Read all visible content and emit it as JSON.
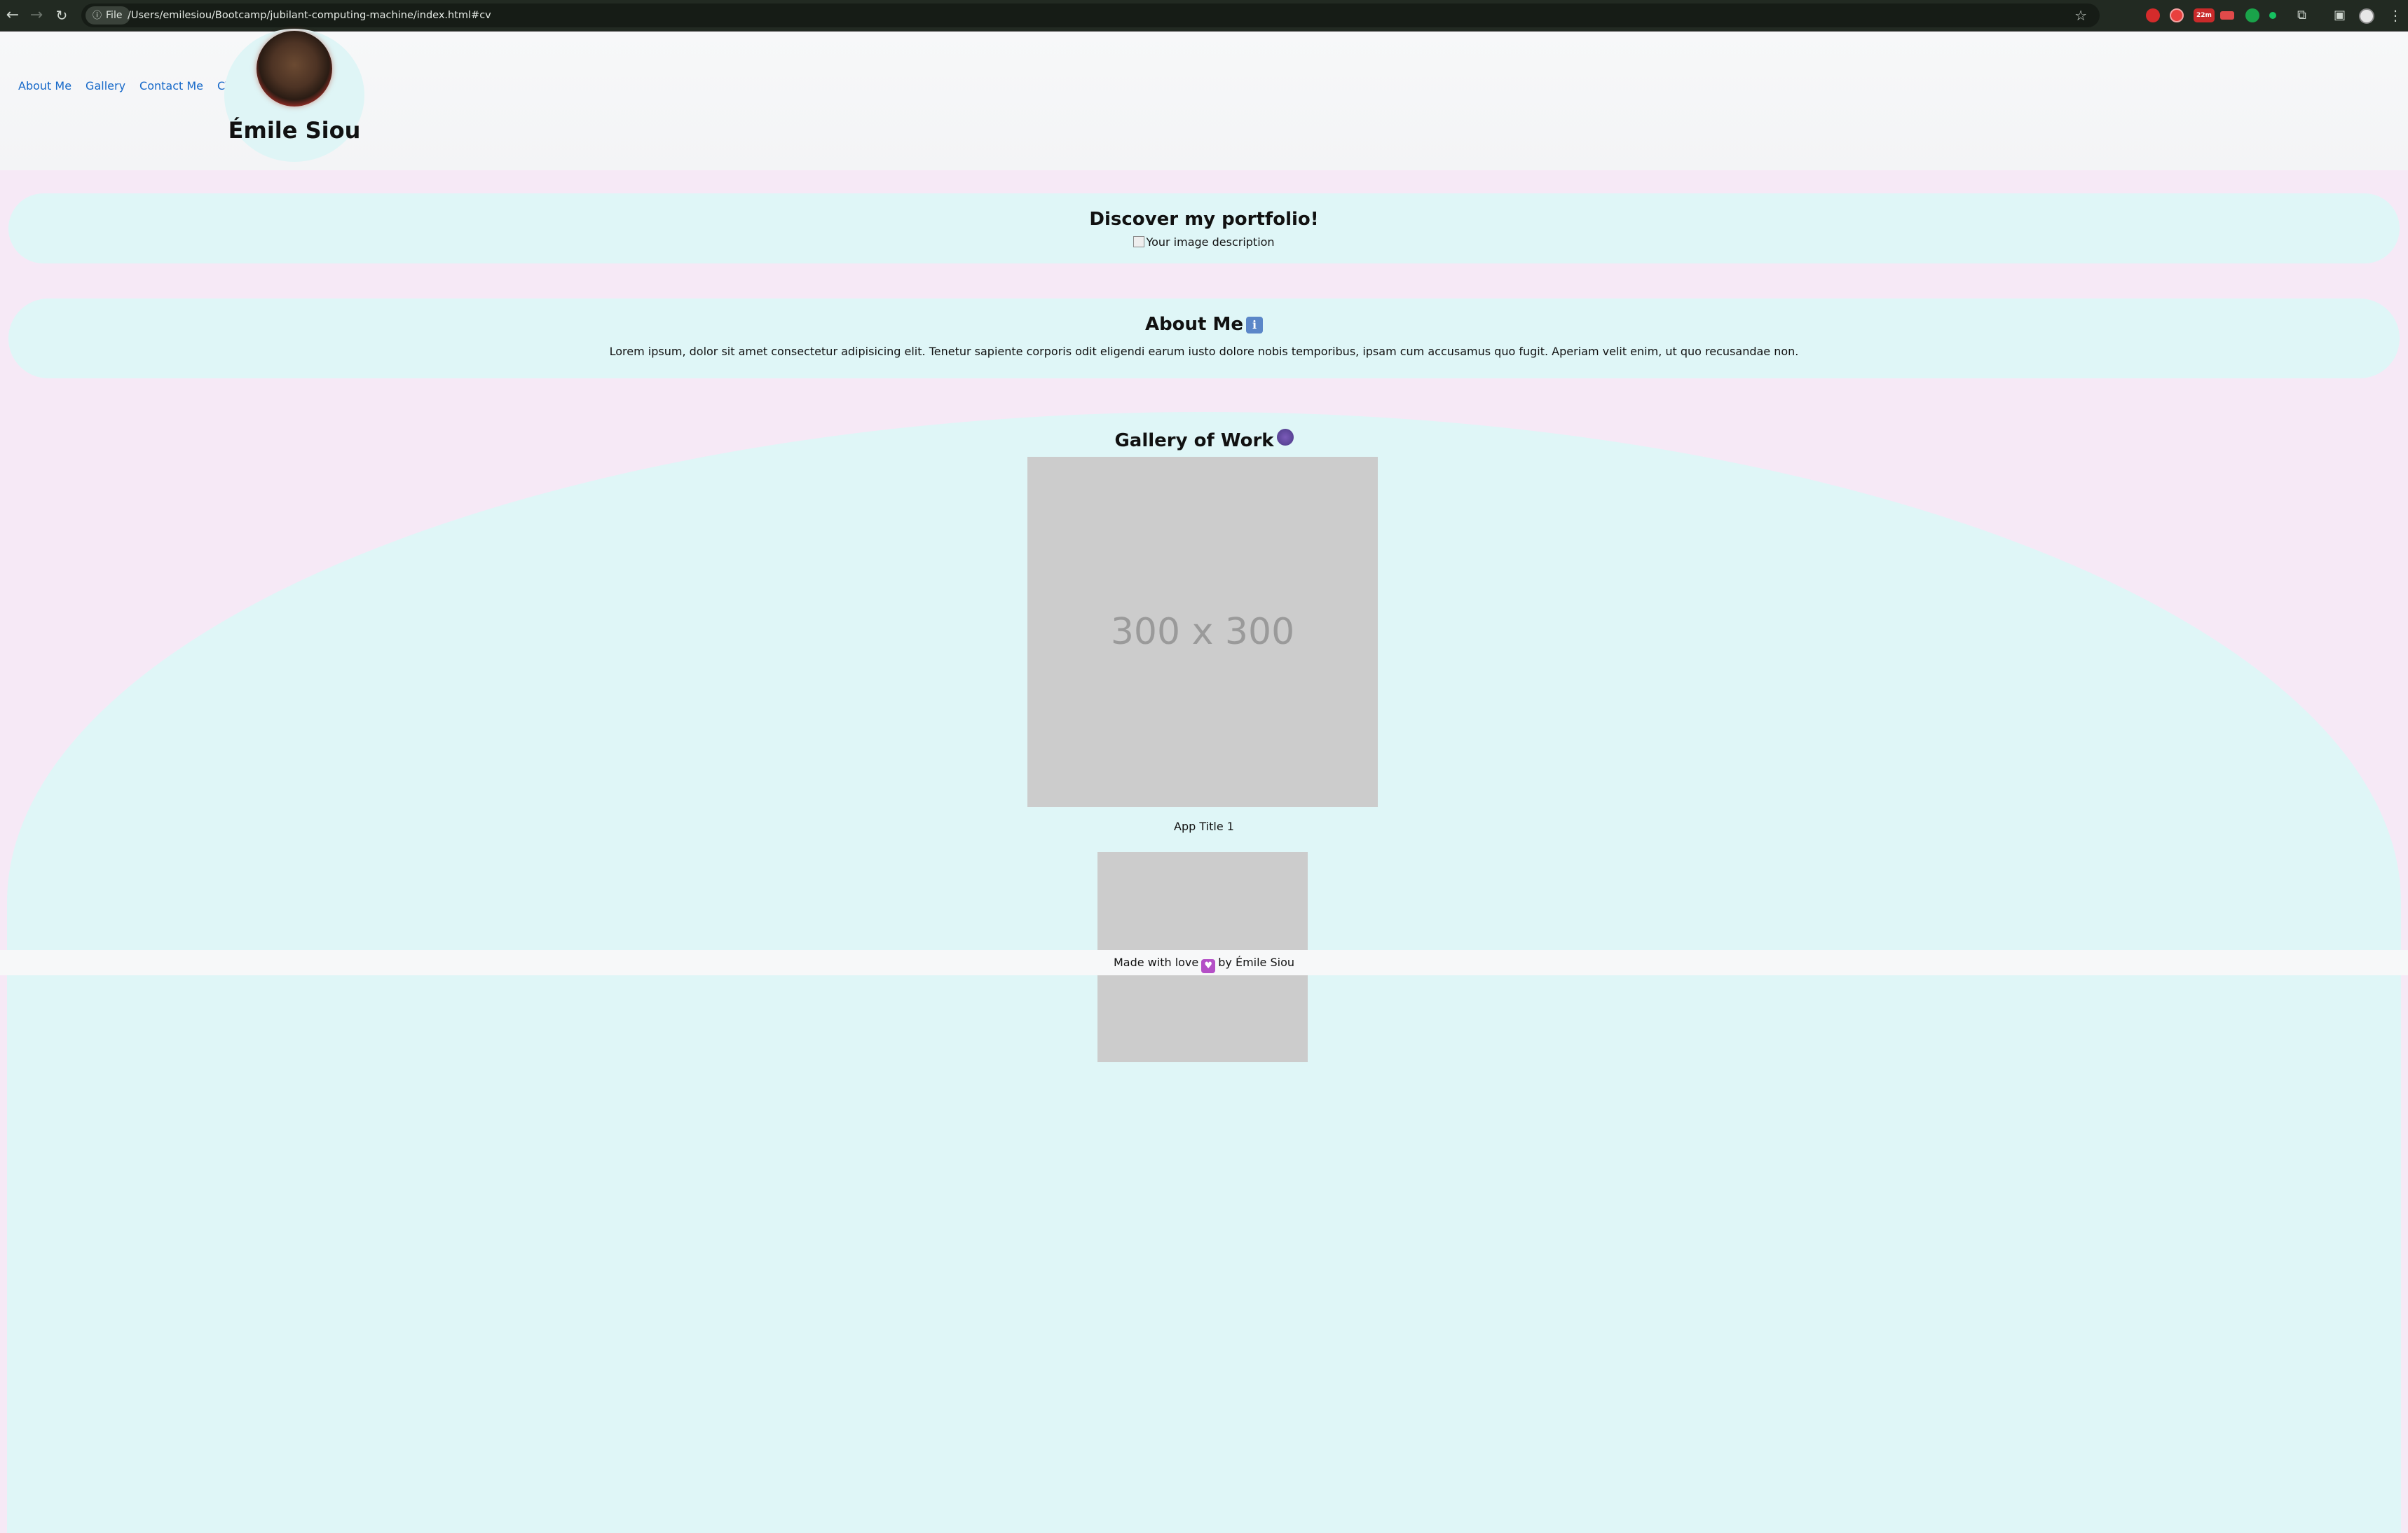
{
  "browser": {
    "url": "/Users/emilesiou/Bootcamp/jubilant-computing-machine/index.html#cv",
    "file_chip": "File",
    "extension_badge": "22m",
    "icons": [
      "back-icon",
      "forward-icon",
      "reload-icon",
      "info-icon",
      "star-icon",
      "extensions-icon",
      "sidebar-icon",
      "profile-icon",
      "menu-icon"
    ]
  },
  "header": {
    "nav": [
      "About Me",
      "Gallery",
      "Contact Me",
      "CV"
    ],
    "site_name": "Émile Siou"
  },
  "hero": {
    "title": "Discover my portfolio!",
    "image_alt": "Your image description"
  },
  "about": {
    "title": "About Me",
    "emoji": "ℹ",
    "text": "Lorem ipsum, dolor sit amet consectetur adipisicing elit. Tenetur sapiente corporis odit eligendi earum iusto dolore nobis temporibus, ipsam cum accusamus quo fugit. Aperiam velit enim, ut quo recusandae non."
  },
  "gallery": {
    "title": "Gallery of Work",
    "items": [
      {
        "placeholder": "300 x 300",
        "caption": "App Title 1"
      },
      {
        "placeholder": "",
        "caption": ""
      }
    ]
  },
  "footer": {
    "prefix": "Made with love",
    "heart": "♥",
    "suffix": "by Émile Siou"
  },
  "colors": {
    "page_bg": "#f6e9f6",
    "section_bg": "#dff6f7",
    "link": "#1769c9",
    "placeholder": "#cccccc"
  }
}
